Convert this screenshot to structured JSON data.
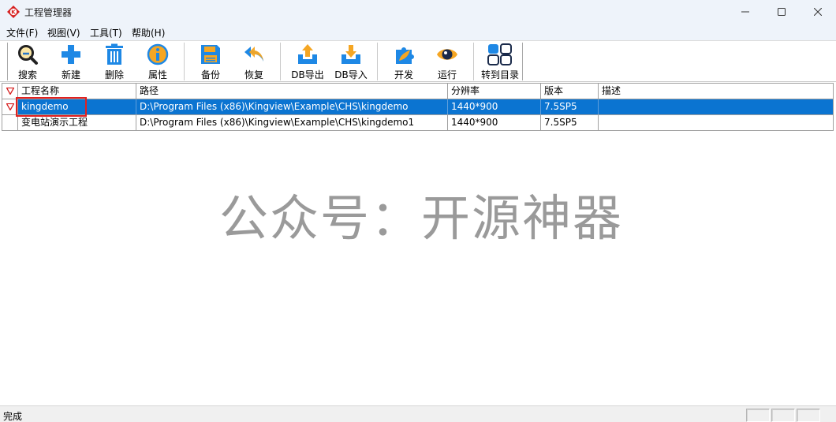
{
  "window": {
    "title": "工程管理器"
  },
  "menu": [
    "文件(F)",
    "视图(V)",
    "工具(T)",
    "帮助(H)"
  ],
  "toolbar": [
    {
      "label": "搜索",
      "icon": "search-icon"
    },
    {
      "label": "新建",
      "icon": "plus-icon"
    },
    {
      "label": "删除",
      "icon": "trash-icon"
    },
    {
      "label": "属性",
      "icon": "info-icon"
    },
    {
      "label": "备份",
      "icon": "floppy-icon"
    },
    {
      "label": "恢复",
      "icon": "undo-arrows-icon"
    },
    {
      "label": "DB导出",
      "icon": "tray-upload-icon"
    },
    {
      "label": "DB导入",
      "icon": "tray-download-icon"
    },
    {
      "label": "开发",
      "icon": "puzzle-icon"
    },
    {
      "label": "运行",
      "icon": "eye-icon"
    },
    {
      "label": "转到目录",
      "icon": "grid-icon"
    }
  ],
  "table": {
    "columns": [
      "工程名称",
      "路径",
      "分辨率",
      "版本",
      "描述"
    ],
    "rows": [
      {
        "name": "kingdemo",
        "path": "D:\\Program Files (x86)\\Kingview\\Example\\CHS\\kingdemo",
        "resolution": "1440*900",
        "version": "7.5SP5",
        "description": "",
        "selected": true
      },
      {
        "name": "变电站演示工程",
        "path": "D:\\Program Files (x86)\\Kingview\\Example\\CHS\\kingdemo1",
        "resolution": "1440*900",
        "version": "7.5SP5",
        "description": "",
        "selected": false
      }
    ]
  },
  "watermark": "公众号：开源神器",
  "status": {
    "text": "完成"
  },
  "colors": {
    "selection": "#0b74d1",
    "accent_blue": "#1e88e5",
    "accent_orange": "#f5a623",
    "highlight": "#e12020"
  }
}
